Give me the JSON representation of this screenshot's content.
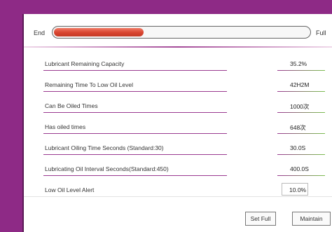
{
  "gauge": {
    "end_label": "End",
    "full_label": "Full",
    "fill_fraction": 0.352
  },
  "params": [
    {
      "label": "Lubricant Remaining Capacity",
      "value": "35.2%"
    },
    {
      "label": "Remaining Time To Low Oil Level",
      "value": "42H2M"
    },
    {
      "label": "Can Be Oiled Times",
      "value": "1000次"
    },
    {
      "label": "Has oiled times",
      "value": "648次"
    },
    {
      "label": "Lubricant Oiling Time Seconds (Standard:30)",
      "value": "30.0S"
    },
    {
      "label": "Lubricating Oil Interval Seconds(Standard:450)",
      "value": "400.0S"
    },
    {
      "label": "Low Oil Level Alert",
      "value": "10.0%"
    }
  ],
  "buttons": {
    "set_full": "Set Full",
    "maintain": "Maintain"
  },
  "colors": {
    "frame": "#8e2a86",
    "gauge_fill": "#d8442f",
    "separator": "#9a3a90",
    "value_accent": "#7bbf4f"
  }
}
